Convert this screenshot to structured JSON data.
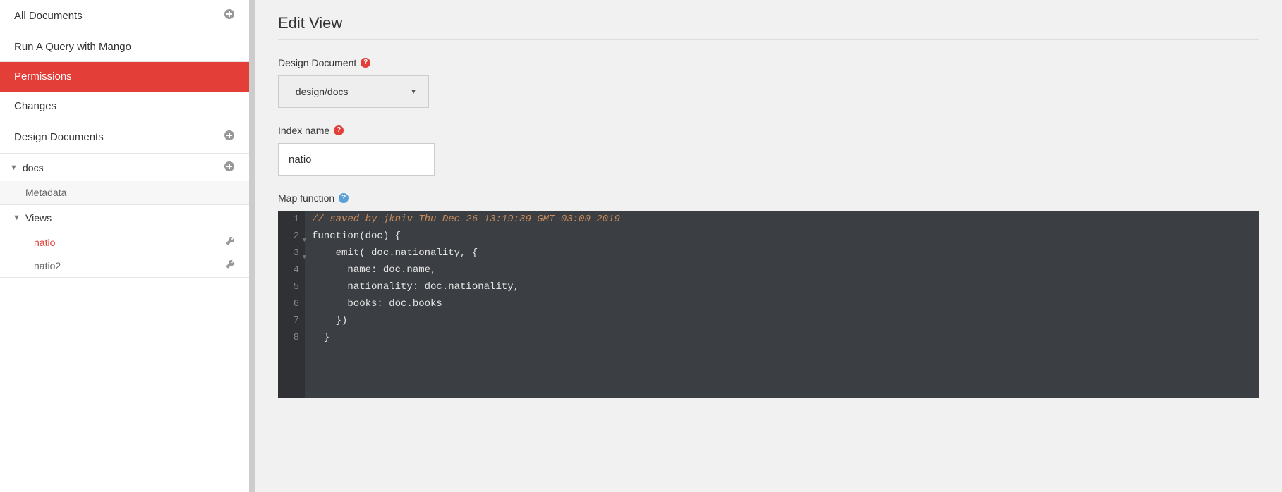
{
  "sidebar": {
    "all_documents": "All Documents",
    "mango": "Run A Query with Mango",
    "permissions": "Permissions",
    "changes": "Changes",
    "design_documents": "Design Documents",
    "docs": "docs",
    "metadata": "Metadata",
    "views": "Views",
    "view_items": [
      {
        "label": "natio",
        "active": true
      },
      {
        "label": "natio2",
        "active": false
      }
    ]
  },
  "main": {
    "title": "Edit View",
    "design_doc_label": "Design Document",
    "design_doc_value": "_design/docs",
    "index_name_label": "Index name",
    "index_name_value": "natio",
    "map_function_label": "Map function",
    "code_lines": [
      "// saved by jkniv Thu Dec 26 13:19:39 GMT-03:00 2019",
      "function(doc) {",
      "    emit( doc.nationality, {",
      "      name: doc.name,",
      "      nationality: doc.nationality,",
      "      books: doc.books",
      "    })",
      "  }"
    ]
  }
}
